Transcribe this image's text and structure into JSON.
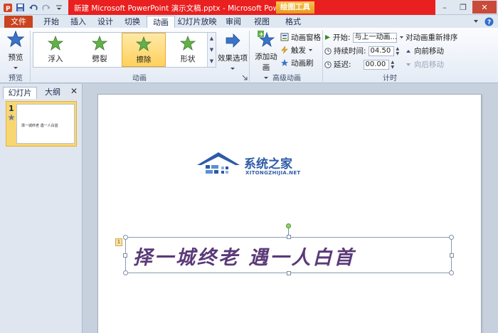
{
  "window": {
    "title": "新建 Microsoft PowerPoint 演示文稿.pptx - Microsoft PowerPo...",
    "tool_tab_label": "绘图工具",
    "controls": {
      "minimize": "–",
      "restore": "❐",
      "close": "✕"
    }
  },
  "qat": {
    "icons": [
      "save-icon",
      "undo-icon",
      "redo-icon",
      "customize-icon"
    ]
  },
  "tabs": {
    "file": "文件",
    "items": [
      "开始",
      "插入",
      "设计",
      "切换",
      "动画",
      "幻灯片放映",
      "审阅",
      "视图",
      "格式"
    ],
    "active": "动画"
  },
  "ribbon": {
    "preview": {
      "label": "预览",
      "group": "预览"
    },
    "animations": {
      "group": "动画",
      "items": [
        {
          "label": "浮入",
          "selected": false
        },
        {
          "label": "劈裂",
          "selected": false
        },
        {
          "label": "擦除",
          "selected": true
        },
        {
          "label": "形状",
          "selected": false
        }
      ],
      "effect_options": "效果选项"
    },
    "advanced": {
      "group": "高级动画",
      "add_animation": "添加动画",
      "animation_pane": "动画窗格",
      "trigger": "触发",
      "painter": "动画刷"
    },
    "timing": {
      "group": "计时",
      "start_label": "开始:",
      "start_value": "与上一动画...",
      "duration_label": "持续时间:",
      "duration_value": "04.50",
      "delay_label": "延迟:",
      "delay_value": "00.00"
    },
    "reorder": {
      "title": "对动画重新排序",
      "forward": "向前移动",
      "backward": "向后移动"
    }
  },
  "left_panel": {
    "tabs": [
      "幻灯片",
      "大纲"
    ],
    "close": "✕",
    "slide_number": "1",
    "thumb_text": "择一城终老   遇一人白首"
  },
  "slide": {
    "watermark_main": "系统之家",
    "watermark_sub": "XITONGZHIJIA.NET",
    "anim_tag": "1",
    "text": "择一城终老   遇一人白首"
  },
  "colors": {
    "title_red": "#ea1f1f",
    "file_tab": "#c9431f",
    "selected_anim": "#ffd15c",
    "poem_text": "#5a3a78",
    "watermark_blue": "#2d5ba8"
  }
}
